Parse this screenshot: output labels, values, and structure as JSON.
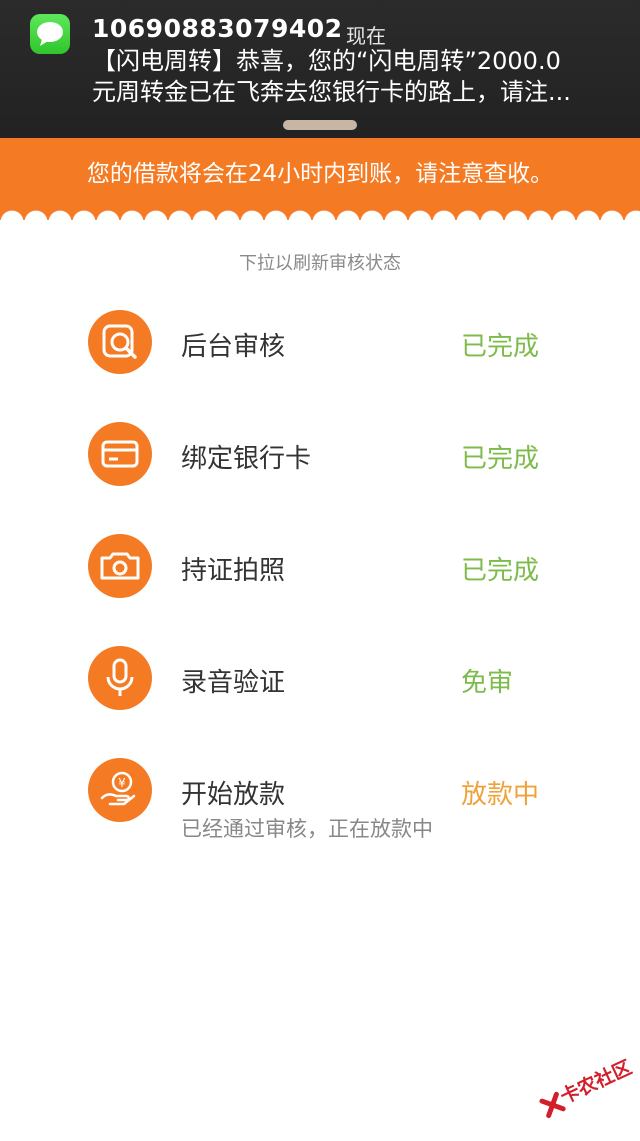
{
  "notification": {
    "icon": "messages-icon",
    "sender": "10690883079402",
    "time": "现在",
    "message_line1": "【闪电周转】恭喜，您的“闪电周转”2000.0",
    "message_line2": "元周转金已在飞奔去您银行卡的路上，请注..."
  },
  "banner": {
    "text": "您的借款将会在24小时内到账，请注意查收。",
    "color": "#f47b23"
  },
  "pull_hint": "下拉以刷新审核状态",
  "steps": [
    {
      "icon": "magnifier-review-icon",
      "label": "后台审核",
      "status": "已完成",
      "status_color": "#7dbb4a"
    },
    {
      "icon": "bank-card-icon",
      "label": "绑定银行卡",
      "status": "已完成",
      "status_color": "#7dbb4a"
    },
    {
      "icon": "camera-icon",
      "label": "持证拍照",
      "status": "已完成",
      "status_color": "#7dbb4a"
    },
    {
      "icon": "microphone-icon",
      "label": "录音验证",
      "status": "免审",
      "status_color": "#7dbb4a"
    },
    {
      "icon": "yen-hand-icon",
      "label": "开始放款",
      "status": "放款中",
      "status_color": "#f0a23a",
      "subtitle": "已经通过审核，正在放款中"
    }
  ],
  "watermark": "卡农社区"
}
